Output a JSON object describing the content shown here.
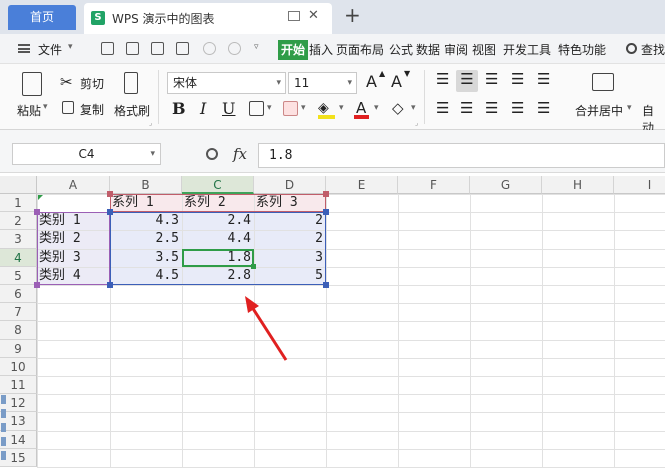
{
  "titlebar": {
    "home_tab": "首页",
    "doc_tab_logo": "S",
    "doc_tab_title": "WPS 演示中的图表",
    "close_glyph": "✕",
    "new_tab_glyph": "+"
  },
  "menu": {
    "file_label": "文件",
    "items": [
      "开始",
      "插入",
      "页面布局",
      "公式",
      "数据",
      "审阅",
      "视图",
      "开发工具",
      "特色功能"
    ],
    "active_index": 0,
    "search_label": "查找"
  },
  "ribbon": {
    "paste": "粘贴",
    "cut": "剪切",
    "copy": "复制",
    "format_painter": "格式刷",
    "font_name": "宋体",
    "font_size": "11",
    "grow_font": "A",
    "shrink_font": "A",
    "bold": "B",
    "italic": "I",
    "underline": "U",
    "merge_center": "合并居中",
    "auto_wrap": "自动"
  },
  "formula_bar": {
    "name_box": "C4",
    "fx": "fx",
    "value": "1.8"
  },
  "sheet": {
    "columns": [
      "A",
      "B",
      "C",
      "D",
      "E",
      "F",
      "G",
      "H",
      "I"
    ],
    "rows": [
      "1",
      "2",
      "3",
      "4",
      "5",
      "6",
      "7",
      "8",
      "9",
      "10",
      "11",
      "12",
      "13",
      "14",
      "15"
    ],
    "selected_cell": "C4",
    "header_row": [
      "",
      "系列 1",
      "系列 2",
      "系列 3"
    ],
    "data_rows": [
      [
        "类别 1",
        "4.3",
        "2.4",
        "2"
      ],
      [
        "类别 2",
        "2.5",
        "4.4",
        "2"
      ],
      [
        "类别 3",
        "3.5",
        "1.8",
        "3"
      ],
      [
        "类别 4",
        "4.5",
        "2.8",
        "5"
      ]
    ],
    "colors": {
      "selection": "#2f9c48",
      "category_range": "#9b5fb5",
      "series_range": "#c05d6a",
      "data_range": "#3c5fb8",
      "arrow": "#e02020"
    }
  }
}
